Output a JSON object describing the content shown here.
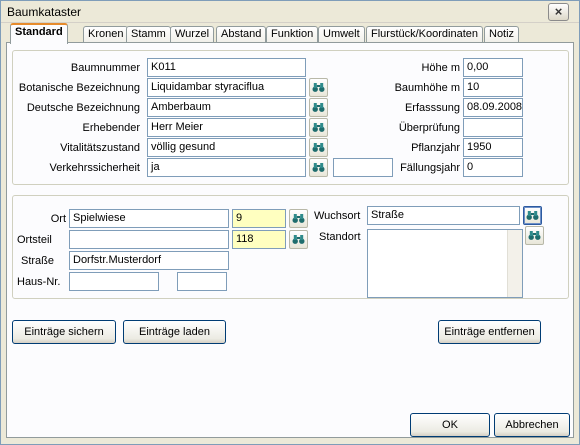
{
  "window": {
    "title": "Baumkataster",
    "close_label": "×"
  },
  "tabs": [
    "Standard",
    "Kronen",
    "Stamm",
    "Wurzel",
    "Abstand",
    "Funktion",
    "Umwelt",
    "Flurstück/Koordinaten",
    "Notiz"
  ],
  "left": {
    "baumnummer": {
      "label": "Baumnummer",
      "value": "K011"
    },
    "botanisch": {
      "label": "Botanische Bezeichnung",
      "value": "Liquidambar styraciflua"
    },
    "deutsch": {
      "label": "Deutsche Bezeichnung",
      "value": "Amberbaum"
    },
    "erhebender": {
      "label": "Erhebender",
      "value": "Herr Meier"
    },
    "vitalitaet": {
      "label": "Vitalitätszustand",
      "value": "völlig gesund"
    },
    "verkehr": {
      "label": "Verkehrssicherheit",
      "value": "ja"
    }
  },
  "right": {
    "hoehe": {
      "label": "Höhe m",
      "value": "0,00"
    },
    "baumhoehe": {
      "label": "Baumhöhe m",
      "value": "10"
    },
    "erfassung": {
      "label": "Erfasssung",
      "value": "08.09.2008"
    },
    "pruefung": {
      "label": "Überprüfung",
      "value": ""
    },
    "pflanzjahr": {
      "label": "Pflanzjahr",
      "value": "1950"
    },
    "faellung": {
      "label": "Fällungsjahr",
      "value": "0"
    }
  },
  "location": {
    "ort": {
      "label": "Ort",
      "value": "Spielwiese",
      "code": "9"
    },
    "ortsteil": {
      "label": "Ortsteil",
      "value": "",
      "code": "118"
    },
    "strasse": {
      "label": "Straße",
      "value": "Dorfstr.Musterdorf"
    },
    "hausnr": {
      "label": "Haus-Nr.",
      "value": ""
    },
    "wuchsort": {
      "label": "Wuchsort",
      "value": "Straße"
    },
    "standort": {
      "label": "Standort",
      "value": ""
    }
  },
  "buttons": {
    "save": "Einträge sichern",
    "load": "Einträge laden",
    "remove": "Einträge entfernen",
    "ok": "OK",
    "cancel": "Abbrechen"
  },
  "icons": {
    "lookup": "binoculars-icon"
  }
}
